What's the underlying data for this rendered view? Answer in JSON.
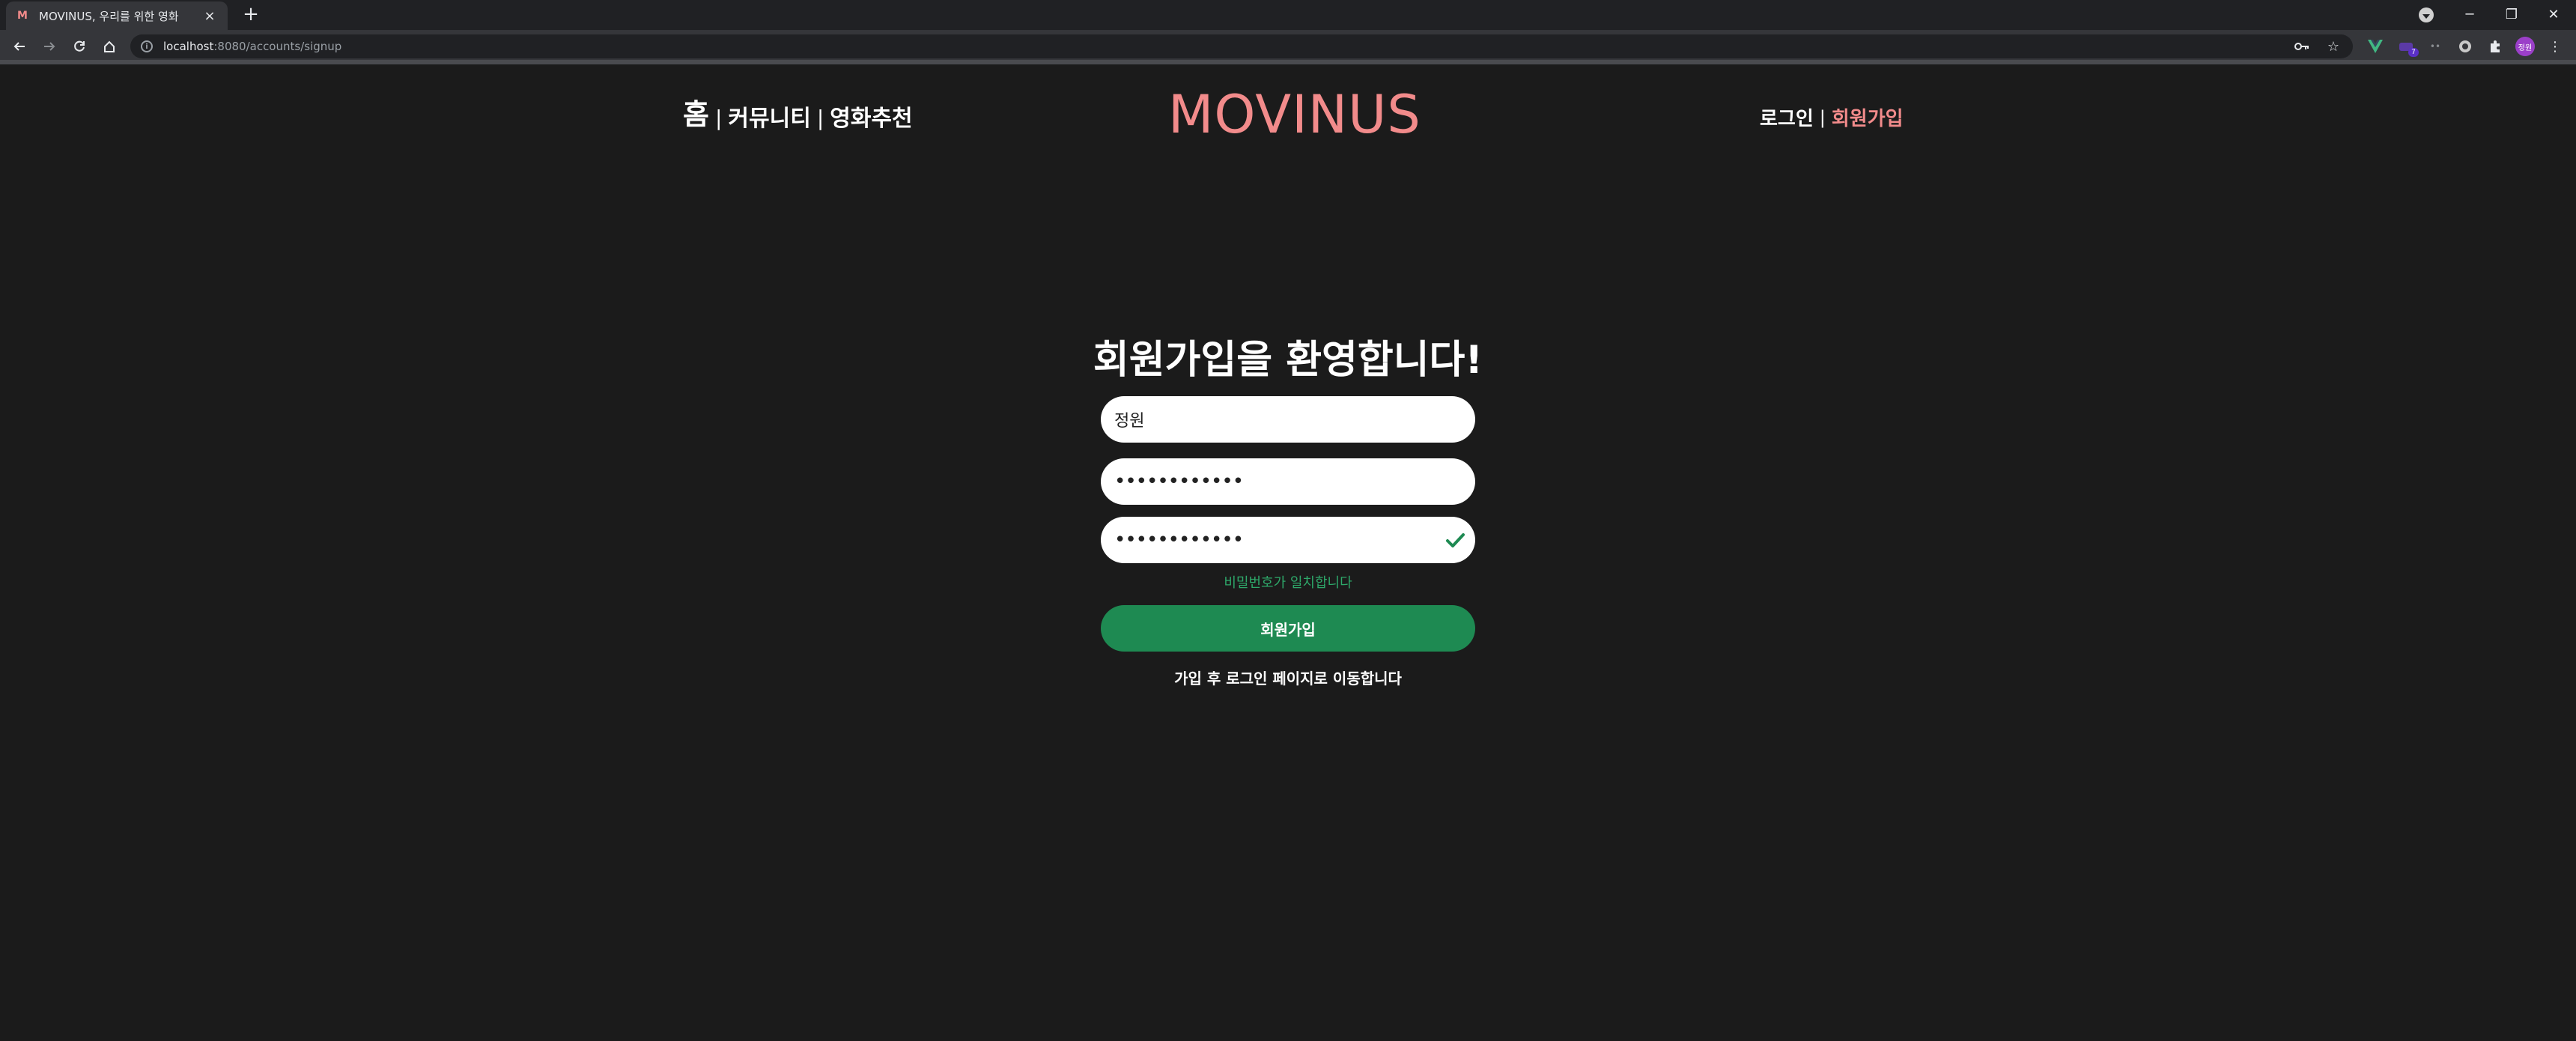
{
  "browser": {
    "tab_title": "MOVINUS, 우리를 위한 영화",
    "url_host": "localhost",
    "url_path": ":8080/accounts/signup",
    "profile_initials": "정원",
    "extension_badge": "7"
  },
  "nav": {
    "home": "홈",
    "community": "커뮤니티",
    "recommend": "영화추천",
    "separator": "|",
    "login": "로그인",
    "signup": "회원가입"
  },
  "logo": "MOVINUS",
  "form": {
    "title": "회원가입을 환영합니다!",
    "username_value": "정원",
    "password_value": "••••••••••••",
    "password_confirm_value": "••••••••••••",
    "match_message": "비밀번호가 일치합니다",
    "submit_label": "회원가입",
    "redirect_note": "가입 후 로그인 페이지로 이동합니다"
  },
  "colors": {
    "background": "#1b1b1b",
    "brand_pink": "#f28b8b",
    "success_green": "#1e8a52",
    "match_text_green": "#2ea86a"
  }
}
